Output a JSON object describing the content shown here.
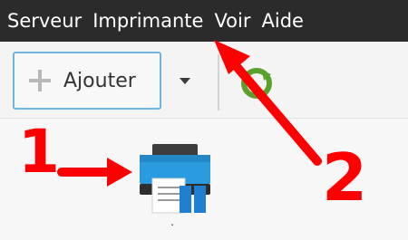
{
  "menubar": {
    "items": [
      {
        "label": "Serveur"
      },
      {
        "label": "Imprimante"
      },
      {
        "label": "Voir"
      },
      {
        "label": "Aide"
      }
    ]
  },
  "toolbar": {
    "add_label": "Ajouter",
    "icons": {
      "plus": "plus-icon",
      "dropdown": "chevron-down-icon",
      "refresh": "refresh-icon"
    }
  },
  "content": {
    "printer": {
      "icon": "printer-icon",
      "label": "."
    }
  },
  "annotations": {
    "step_one": "1",
    "step_two": "2",
    "color": "#ff0000"
  },
  "colors": {
    "menubar_bg": "#2b2b2b",
    "accent_border": "#6fb3e0",
    "printer_blue": "#2b8fd8",
    "annotation_red": "#ff0000"
  }
}
